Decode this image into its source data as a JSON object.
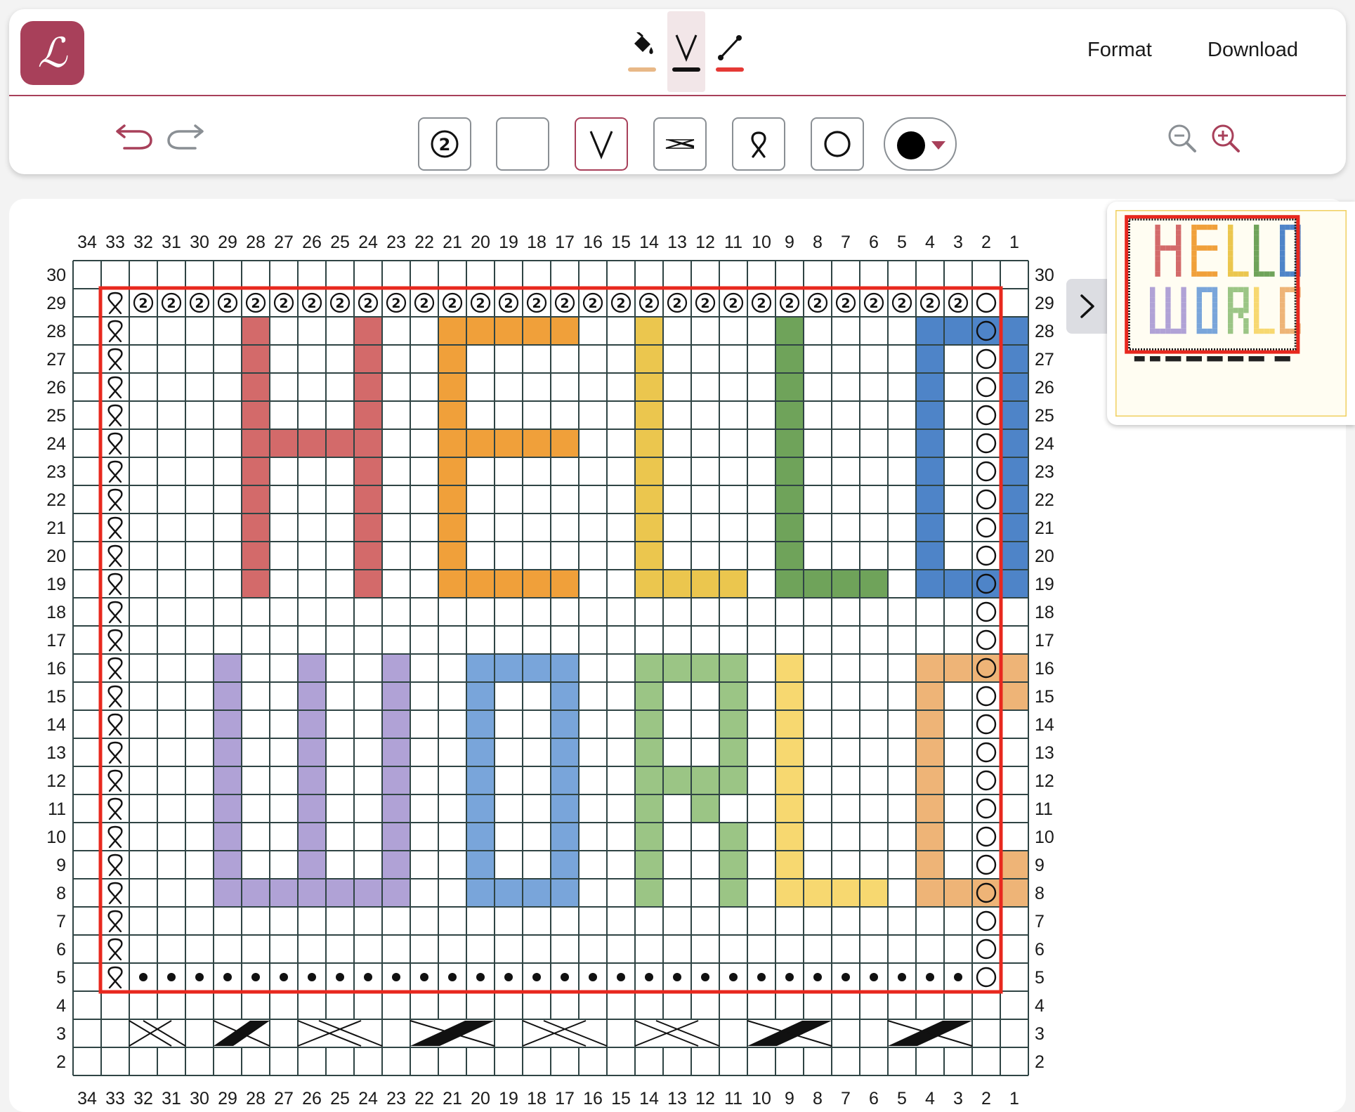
{
  "header": {
    "logo_glyph": "ℒ",
    "modes": [
      {
        "name": "fill-mode",
        "icon": "paint-bucket-icon",
        "underline": "#e8b887",
        "active": false
      },
      {
        "name": "stitch-mode",
        "icon": "stitch-v-icon",
        "underline": "#111111",
        "active": true
      },
      {
        "name": "line-mode",
        "icon": "line-draw-icon",
        "underline": "#e53935",
        "active": false
      }
    ],
    "menu": {
      "format": "Format",
      "download": "Download"
    }
  },
  "toolbar": {
    "stitches": [
      {
        "key": "twisted-knit-2",
        "icon": "twist-2-icon",
        "selected": false
      },
      {
        "key": "empty",
        "icon": "blank-stitch-icon",
        "selected": false
      },
      {
        "key": "slip",
        "icon": "slip-v-icon",
        "selected": true
      },
      {
        "key": "cable",
        "icon": "cable-icon",
        "selected": false
      },
      {
        "key": "twisted-knit",
        "icon": "twisted-loop-icon",
        "selected": false
      },
      {
        "key": "purl",
        "icon": "purl-circle-icon",
        "selected": false
      }
    ],
    "current_color": "#000000",
    "undo_icon": "undo-icon",
    "redo_icon": "redo-icon",
    "zoom_out_icon": "zoom-out-icon",
    "zoom_in_icon": "zoom-in-icon"
  },
  "chart": {
    "columns": 34,
    "rows": 29,
    "row_range": [
      2,
      30
    ],
    "border_color": "#e8281e",
    "grid_color": "#2f4444",
    "border_rows": [
      5,
      29
    ],
    "border_cols": [
      2,
      33
    ],
    "symbol_rows": {
      "29": {
        "fill": "twist-2",
        "left": "twisted-loop",
        "right": "purl"
      },
      "5": {
        "fill": "dot",
        "left": "twisted-loop",
        "right": "purl"
      }
    },
    "side_symbols": {
      "left": "twisted-loop",
      "right": "purl",
      "rows": [
        5,
        28
      ]
    },
    "palette": {
      "A": "#d36a6a",
      "B": "#f0a03a",
      "C": "#ebc64e",
      "D": "#6fa35a",
      "E": "#4e84c8",
      "F": "#b0a2d6",
      "G": "#79a5da",
      "H": "#9bc585",
      "I": "#f7d870",
      "J": "#eeb477"
    },
    "pattern": [
      "..................................",
      "..................................",
      "......A...A..BBBBB..C....D....EEEE",
      "......A...A..B......C....D....E..E",
      "......A...A..B......C....D....E..E",
      "......A...A..B......C....D....E..E",
      "......AAAAA..BBBBB..C....D....E..E",
      "......A...A..B......C....D....E..E",
      "......A...A..B......C....D....E..E",
      "......A...A..B......C....D....E..E",
      "......A...A..B......C....D....E..E",
      "......A...A..BBBBB..CCCC.DDDD.EEEE",
      "..................................",
      "..................................",
      ".....F..F..F..GGGG..HHHH.I....JJJJ",
      ".....F..F..F..G..G..H..H.I....J..JJ",
      ".....F..F..F..G..G..H..H.I....J...J",
      ".....F..F..F..G..G..H..H.I....J...J",
      ".....F..F..F..G..G..HHHH.I....J...J",
      ".....F..F..F..G..G..H.H..I....J...J",
      ".....F..F..F..G..G..H..H.I....J...J",
      ".....F..F..F..G..G..H..H.I....J..JJ",
      ".....FFFFFFF..GGGG..H..H.IIII.JJJJ",
      "..................................",
      "..................................",
      "..................................",
      "..................................",
      "..................................",
      ".................................."
    ],
    "cables": [
      {
        "cols": [
          31,
          32
        ],
        "style": "cross-open"
      },
      {
        "cols": [
          28,
          29
        ],
        "style": "cross-solid"
      },
      {
        "cols": [
          24,
          26
        ],
        "style": "cross-open"
      },
      {
        "cols": [
          20,
          22
        ],
        "style": "cross-solid"
      },
      {
        "cols": [
          16,
          18
        ],
        "style": "cross-open"
      },
      {
        "cols": [
          12,
          14
        ],
        "style": "cross-open"
      },
      {
        "cols": [
          8,
          10
        ],
        "style": "cross-solid"
      },
      {
        "cols": [
          3,
          5
        ],
        "style": "cross-solid"
      }
    ]
  },
  "preview": {
    "toggle_icon": "chevron-right-icon"
  }
}
